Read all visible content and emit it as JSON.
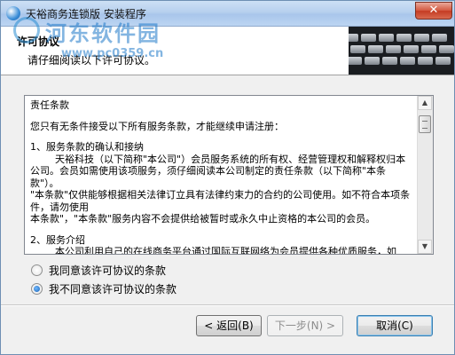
{
  "window": {
    "title": "天裕商务连锁版 安装程序",
    "close_glyph": "✕"
  },
  "watermark": {
    "title": "河东软件园",
    "url": "www.pc0359.cn"
  },
  "header": {
    "title": "许可协议",
    "subtitle": "请仔细阅读以下许可协议。"
  },
  "license": {
    "lines": [
      "责任条款",
      "",
      "您只有无条件接受以下所有服务条款，才能继续申请注册：",
      "",
      "1、服务条款的确认和接纳",
      "        天裕科技（以下简称\"本公司\"）会员服务系统的所有权、经营管理权和解释权归本公司。会员如需使用该项服务，须仔细阅读本公司制定的责任条款（以下简称\"本条款\"）。",
      "\"本条款\"仅供能够根据相关法律订立具有法律约束力的合约的公司使用。如不符合本项条件，请勿使用",
      "本条款\"，\"本条款\"服务内容不会提供给被暂时或永久中止资格的本公司的会员。",
      "",
      "2、服务介绍",
      "        本公司利用自己的在线商务平台通过国际互联网络为会员提供各种优质服务，如"
    ]
  },
  "options": [
    {
      "label": "我同意该许可协议的条款",
      "checked": false
    },
    {
      "label": "我不同意该许可协议的条款",
      "checked": true
    }
  ],
  "buttons": {
    "back": "< 返回(B)",
    "next": "下一步(N) >",
    "cancel": "取消(C)"
  },
  "scrollbar": {
    "up_glyph": "▲",
    "down_glyph": "▼"
  }
}
